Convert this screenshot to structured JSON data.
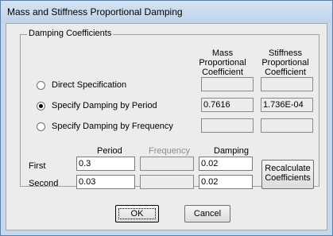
{
  "window": {
    "title": "Mass and Stiffness Proportional Damping"
  },
  "group": {
    "label": "Damping Coefficients"
  },
  "columns": {
    "mass": [
      "Mass",
      "Proportional",
      "Coefficient"
    ],
    "stiffness": [
      "Stiffness",
      "Proportional",
      "Coefficient"
    ]
  },
  "options": [
    {
      "label": "Direct Specification",
      "selected": false,
      "mass_value": "",
      "stiffness_value": ""
    },
    {
      "label": "Specify Damping by Period",
      "selected": true,
      "mass_value": "0.7616",
      "stiffness_value": "1.736E-04"
    },
    {
      "label": "Specify Damping by Frequency",
      "selected": false,
      "mass_value": "",
      "stiffness_value": ""
    }
  ],
  "table": {
    "headers": {
      "period": "Period",
      "frequency": "Frequency",
      "damping": "Damping"
    },
    "rows": [
      {
        "label": "First",
        "period": "0.3",
        "frequency": "",
        "damping": "0.02"
      },
      {
        "label": "Second",
        "period": "0.03",
        "frequency": "",
        "damping": "0.02"
      }
    ]
  },
  "buttons": {
    "recalculate": [
      "Recalculate",
      "Coefficients"
    ],
    "ok": "OK",
    "cancel": "Cancel"
  }
}
